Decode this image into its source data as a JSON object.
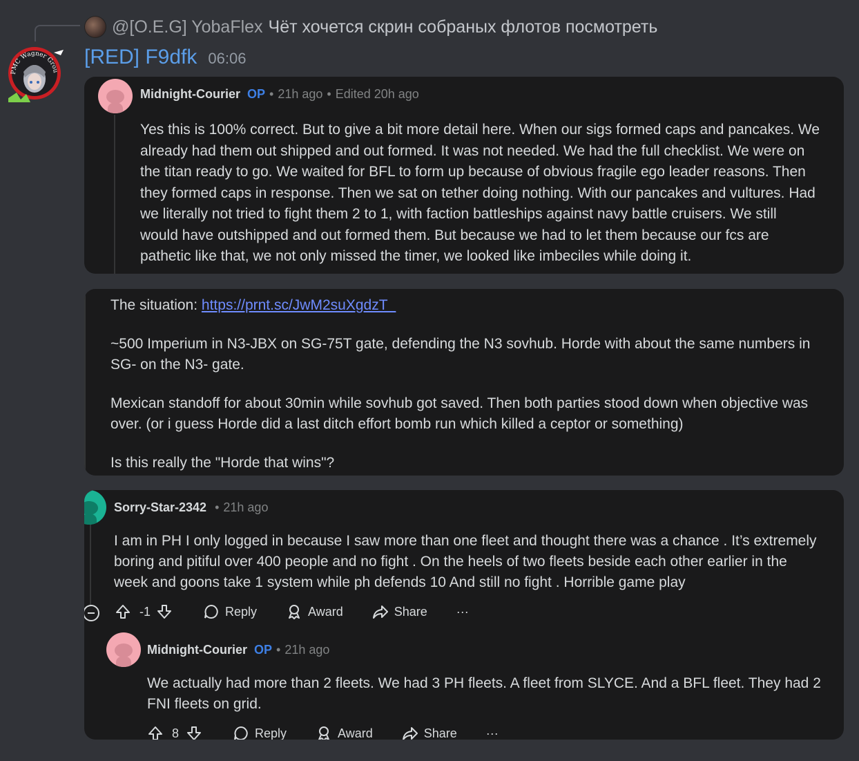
{
  "reply_preview": {
    "author": "@[O.E.G] YobaFlex",
    "text": "Чёт хочется скрин собраных флотов посмотреть"
  },
  "message": {
    "username": "[RED] F9dfk",
    "timestamp": "06:06"
  },
  "comment1": {
    "author": "Midnight-Courier",
    "op": "OP",
    "sep1": "•",
    "time": "21h ago",
    "sep2": "•",
    "edited": "Edited 20h ago",
    "lines": [
      "Yes this is 100% correct. But to give a bit more detail here. When our sigs formed caps and pancakes. We",
      "already had them out shipped and out formed. It was not needed. We had the full checklist. We were on",
      "the titan ready to go. We waited for BFL to form up because of obvious fragile ego leader reasons. Then",
      "they formed caps in response. Then we sat on tether doing nothing. With our pancakes and vultures. Had",
      "we literally not tried to fight them 2 to 1, with faction battleships against navy battle cruisers. We still",
      "would have outshipped and out formed them. But because we had to let them because our fcs are",
      "pathetic like that, we not only missed the timer, we looked like imbeciles while doing it."
    ]
  },
  "post": {
    "situation_label": "The situation:",
    "situation_link": "https://prnt.sc/JwM2suXgdzT_",
    "para2_l1": "~500 Imperium in N3-JBX on SG-75T gate, defending the N3 sovhub. Horde with about the same numbers in",
    "para2_l2": "SG- on the N3- gate.",
    "para3_l1": "Mexican standoff for about 30min while sovhub got saved. Then both parties stood down when objective was",
    "para3_l2": "over. (or i guess Horde did a last ditch effort bomb run which killed a ceptor or something)",
    "para4": "Is this really the \"Horde that wins\"?"
  },
  "comment2": {
    "author": "Sorry-Star-2342",
    "sep": "•",
    "time": "21h ago",
    "lines": [
      "I am in PH I only logged in because I saw more than one fleet and thought there was a chance . It’s extremely",
      "boring and pitiful over 400 people and no fight . On the heels of two fleets beside each other earlier in the",
      "week and goons take 1 system while ph defends 10 And still no fight . Horrible game play"
    ],
    "score": "-1",
    "reply": "Reply",
    "award": "Award",
    "share": "Share",
    "more": "···"
  },
  "comment3": {
    "author": "Midnight-Courier",
    "op": "OP",
    "sep": "•",
    "time": "21h ago",
    "lines": [
      "We actually had more than 2 fleets. We had 3 PH fleets. A fleet from SLYCE. And a BFL fleet. They had 2",
      "FNI fleets on grid."
    ],
    "score": "8",
    "reply": "Reply",
    "award": "Award",
    "share": "Share",
    "more": "···"
  },
  "avatar_text": "PMC Wagner Group"
}
